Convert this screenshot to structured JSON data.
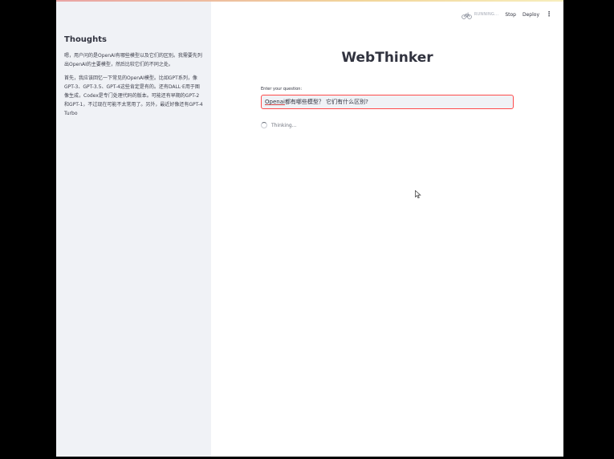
{
  "sidebar": {
    "title": "Thoughts",
    "paragraphs": [
      "嗯，用户问的是OpenAI有哪些模型以及它们的区别。我需要先列出OpenAI的主要模型，然后比较它们的不同之处。",
      "首先，我应该回忆一下常见的OpenAI模型。比如GPT系列，像GPT-3、GPT-3.5、GPT-4这些肯定是有的。还有DALL·E用于图像生成，Codex是专门处理代码的版本。可能还有早期的GPT-2和GPT-1，不过现在可能不太常用了。另外，最近好像还有GPT-4 Turbo"
    ]
  },
  "topbar": {
    "status": "RUNNING...",
    "status_icon": "running-bicycle-icon",
    "stop_label": "Stop",
    "deploy_label": "Deploy",
    "menu_icon": "kebab-menu-icon"
  },
  "main": {
    "title": "WebThinker",
    "question_label": "Enter your question:",
    "question_value_prefix": "Openai",
    "question_value_rest": "都有哪些模型？ 它们有什么区别?",
    "thinking_text": "Thinking..."
  },
  "colors": {
    "accent": "#ff4b4b",
    "sidebar_bg": "#f0f2f6",
    "text": "#31333f"
  }
}
